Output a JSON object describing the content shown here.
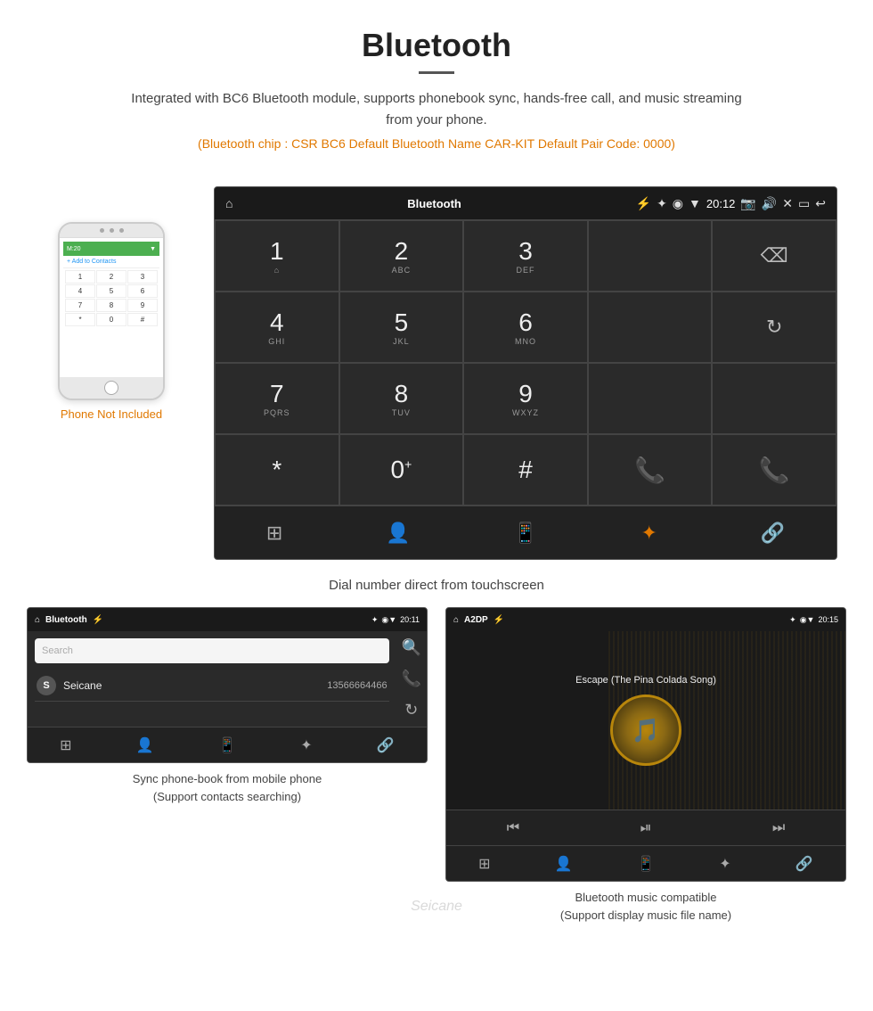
{
  "header": {
    "title": "Bluetooth",
    "subtitle": "Integrated with BC6 Bluetooth module, supports phonebook sync, hands-free call, and music streaming from your phone.",
    "bt_info": "(Bluetooth chip : CSR BC6    Default Bluetooth Name CAR-KIT    Default Pair Code: 0000)"
  },
  "phone": {
    "not_included": "Phone Not Included",
    "keys": [
      "1",
      "2",
      "3",
      "4",
      "5",
      "6",
      "7",
      "8",
      "9",
      "*",
      "0",
      "#"
    ]
  },
  "dialer": {
    "title": "Bluetooth",
    "time": "20:12",
    "keys": [
      {
        "number": "1",
        "letters": "⌂"
      },
      {
        "number": "2",
        "letters": "ABC"
      },
      {
        "number": "3",
        "letters": "DEF"
      },
      {
        "number": "4",
        "letters": "GHI"
      },
      {
        "number": "5",
        "letters": "JKL"
      },
      {
        "number": "6",
        "letters": "MNO"
      },
      {
        "number": "7",
        "letters": "PQRS"
      },
      {
        "number": "8",
        "letters": "TUV"
      },
      {
        "number": "9",
        "letters": "WXYZ"
      },
      {
        "number": "*",
        "letters": ""
      },
      {
        "number": "0",
        "letters": "+"
      },
      {
        "number": "#",
        "letters": ""
      }
    ]
  },
  "caption_main": "Dial number direct from touchscreen",
  "phonebook": {
    "title": "Bluetooth",
    "time": "20:11",
    "search_placeholder": "Search",
    "contact": {
      "initial": "S",
      "name": "Seicane",
      "phone": "13566664466"
    }
  },
  "a2dp": {
    "title": "A2DP",
    "time": "20:15",
    "song_title": "Escape (The Pina Colada Song)"
  },
  "caption_left": {
    "line1": "Sync phone-book from mobile phone",
    "line2": "(Support contacts searching)"
  },
  "caption_right": {
    "line1": "Bluetooth music compatible",
    "line2": "(Support display music file name)"
  },
  "watermark": "Seicane"
}
